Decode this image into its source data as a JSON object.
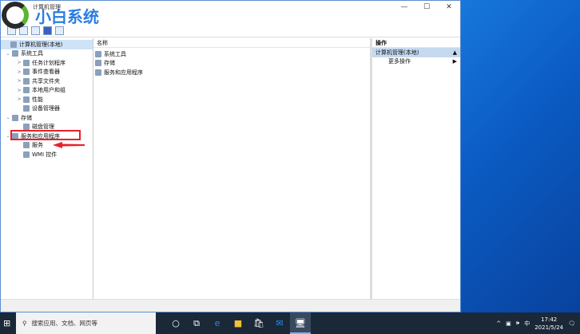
{
  "window": {
    "title": "计算机管理",
    "controls": [
      "—",
      "☐",
      "✕"
    ]
  },
  "logo": {
    "text": "小白系统"
  },
  "tree": [
    {
      "label": "计算机管理(本地)",
      "level": 0,
      "exp": ""
    },
    {
      "label": "系统工具",
      "level": 1,
      "exp": "⌄"
    },
    {
      "label": "任务计划程序",
      "level": 2,
      "exp": ">"
    },
    {
      "label": "事件查看器",
      "level": 2,
      "exp": ">"
    },
    {
      "label": "共享文件夹",
      "level": 2,
      "exp": ">"
    },
    {
      "label": "本地用户和组",
      "level": 2,
      "exp": ">"
    },
    {
      "label": "性能",
      "level": 2,
      "exp": ">"
    },
    {
      "label": "设备管理器",
      "level": 2,
      "exp": ""
    },
    {
      "label": "存储",
      "level": 1,
      "exp": "⌄"
    },
    {
      "label": "磁盘管理",
      "level": 2,
      "exp": ""
    },
    {
      "label": "服务和应用程序",
      "level": 1,
      "exp": "⌄"
    },
    {
      "label": "服务",
      "level": 2,
      "exp": ""
    },
    {
      "label": "WMI 控件",
      "level": 2,
      "exp": ""
    }
  ],
  "list": {
    "header": "名称",
    "items": [
      "系统工具",
      "存储",
      "服务和应用程序"
    ]
  },
  "actions": {
    "header": "操作",
    "section": "计算机管理(本地)",
    "items": [
      "更多操作"
    ]
  },
  "taskbar": {
    "search": "搜索应用、文档、网页等",
    "time": "17:42",
    "date": "2021/5/24",
    "ime": "中"
  }
}
